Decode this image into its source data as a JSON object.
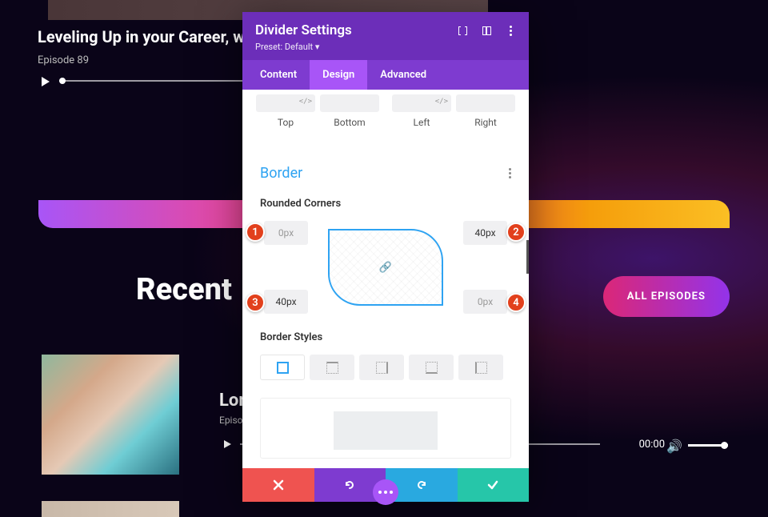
{
  "background": {
    "title": "Leveling Up in your Career, w",
    "subtitle": "Episode 89",
    "recent_heading": "Recent",
    "all_episodes_btn": "ALL EPISODES",
    "episode2_title": "Lor",
    "episode2_sub": "Episo",
    "time": "00:00"
  },
  "panel": {
    "title": "Divider Settings",
    "preset": "Preset: Default ▾",
    "tabs": {
      "content": "Content",
      "design": "Design",
      "advanced": "Advanced"
    },
    "spacing": {
      "top": "Top",
      "bottom": "Bottom",
      "left": "Left",
      "right": "Right"
    },
    "border_section": "Border",
    "rounded_corners_label": "Rounded Corners",
    "corners": {
      "tl": "0px",
      "tr": "40px",
      "bl": "40px",
      "br": "0px"
    },
    "border_styles_label": "Border Styles",
    "callouts": {
      "c1": "1",
      "c2": "2",
      "c3": "3",
      "c4": "4"
    }
  }
}
